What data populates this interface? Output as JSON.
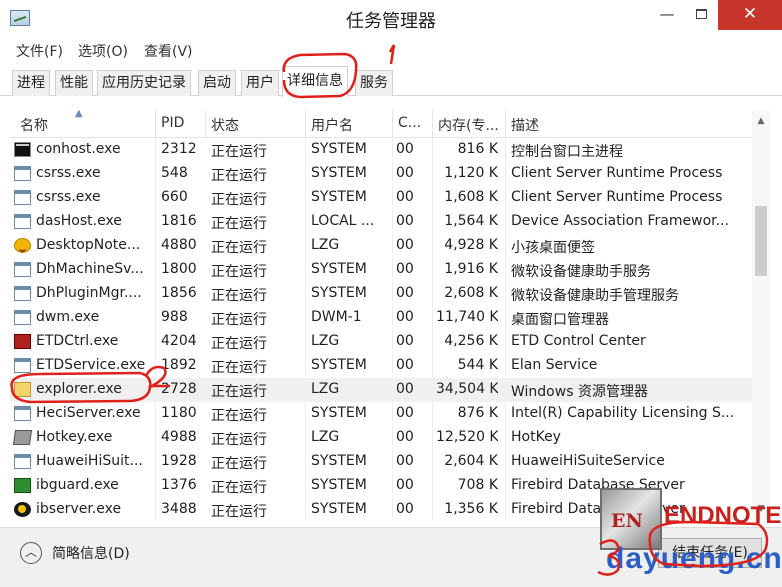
{
  "window": {
    "title": "任务管理器",
    "close_glyph": "✕",
    "min_glyph": "—"
  },
  "menu": [
    "文件(F)",
    "选项(O)",
    "查看(V)"
  ],
  "tabs": [
    "进程",
    "性能",
    "应用历史记录",
    "启动",
    "用户",
    "详细信息",
    "服务"
  ],
  "active_tab": "详细信息",
  "columns": [
    "名称",
    "PID",
    "状态",
    "用户名",
    "C...",
    "内存(专...",
    "描述"
  ],
  "rows": [
    {
      "name": "conhost.exe",
      "pid": "2312",
      "status": "正在运行",
      "user": "SYSTEM",
      "cpu": "00",
      "mem": "816 K",
      "desc": "控制台窗口主进程",
      "icon": "console-icon"
    },
    {
      "name": "csrss.exe",
      "pid": "548",
      "status": "正在运行",
      "user": "SYSTEM",
      "cpu": "00",
      "mem": "1,120 K",
      "desc": "Client Server Runtime Process",
      "icon": "window-icon"
    },
    {
      "name": "csrss.exe",
      "pid": "660",
      "status": "正在运行",
      "user": "SYSTEM",
      "cpu": "00",
      "mem": "1,608 K",
      "desc": "Client Server Runtime Process",
      "icon": "window-icon"
    },
    {
      "name": "dasHost.exe",
      "pid": "1816",
      "status": "正在运行",
      "user": "LOCAL ...",
      "cpu": "00",
      "mem": "1,564 K",
      "desc": "Device Association Framewor...",
      "icon": "window-icon"
    },
    {
      "name": "DesktopNote...",
      "pid": "4880",
      "status": "正在运行",
      "user": "LZG",
      "cpu": "00",
      "mem": "4,928 K",
      "desc": "小孩桌面便签",
      "icon": "smiley-icon"
    },
    {
      "name": "DhMachineSv...",
      "pid": "1800",
      "status": "正在运行",
      "user": "SYSTEM",
      "cpu": "00",
      "mem": "1,916 K",
      "desc": "微软设备健康助手服务",
      "icon": "window-icon"
    },
    {
      "name": "DhPluginMgr....",
      "pid": "1856",
      "status": "正在运行",
      "user": "SYSTEM",
      "cpu": "00",
      "mem": "2,608 K",
      "desc": "微软设备健康助手管理服务",
      "icon": "window-icon"
    },
    {
      "name": "dwm.exe",
      "pid": "988",
      "status": "正在运行",
      "user": "DWM-1",
      "cpu": "00",
      "mem": "11,740 K",
      "desc": "桌面窗口管理器",
      "icon": "window-icon"
    },
    {
      "name": "ETDCtrl.exe",
      "pid": "4204",
      "status": "正在运行",
      "user": "LZG",
      "cpu": "00",
      "mem": "4,256 K",
      "desc": "ETD Control Center",
      "icon": "etd-icon"
    },
    {
      "name": "ETDService.exe",
      "pid": "1892",
      "status": "正在运行",
      "user": "SYSTEM",
      "cpu": "00",
      "mem": "544 K",
      "desc": "Elan Service",
      "icon": "window-icon"
    },
    {
      "name": "explorer.exe",
      "pid": "2728",
      "status": "正在运行",
      "user": "LZG",
      "cpu": "00",
      "mem": "34,504 K",
      "desc": "Windows 资源管理器",
      "icon": "folder-icon"
    },
    {
      "name": "HeciServer.exe",
      "pid": "1180",
      "status": "正在运行",
      "user": "SYSTEM",
      "cpu": "00",
      "mem": "876 K",
      "desc": "Intel(R) Capability Licensing S...",
      "icon": "window-icon"
    },
    {
      "name": "Hotkey.exe",
      "pid": "4988",
      "status": "正在运行",
      "user": "LZG",
      "cpu": "00",
      "mem": "12,520 K",
      "desc": "HotKey",
      "icon": "hotkey-icon"
    },
    {
      "name": "HuaweiHiSuit...",
      "pid": "1928",
      "status": "正在运行",
      "user": "SYSTEM",
      "cpu": "00",
      "mem": "2,604 K",
      "desc": "HuaweiHiSuiteService",
      "icon": "window-icon"
    },
    {
      "name": "ibguard.exe",
      "pid": "1376",
      "status": "正在运行",
      "user": "SYSTEM",
      "cpu": "00",
      "mem": "708 K",
      "desc": "Firebird Database Server",
      "icon": "ibguard-icon"
    },
    {
      "name": "ibserver.exe",
      "pid": "3488",
      "status": "正在运行",
      "user": "SYSTEM",
      "cpu": "00",
      "mem": "1,356 K",
      "desc": "Firebird Database Server",
      "icon": "ibserver-icon"
    }
  ],
  "selected_row": "explorer.exe",
  "footer": {
    "fewer_details": "简略信息(D)",
    "end_task": "结束任务(E)",
    "fewer_glyph": "︿"
  },
  "watermark": {
    "badge": "EN",
    "brand": "ENDNOTE",
    "site": "dayueng.cn"
  },
  "annotations": [
    "1",
    "2",
    "3"
  ],
  "colors": {
    "annotation": "#e0201a",
    "close_button": "#c8352b",
    "selected_row": "#f0f0f0"
  }
}
